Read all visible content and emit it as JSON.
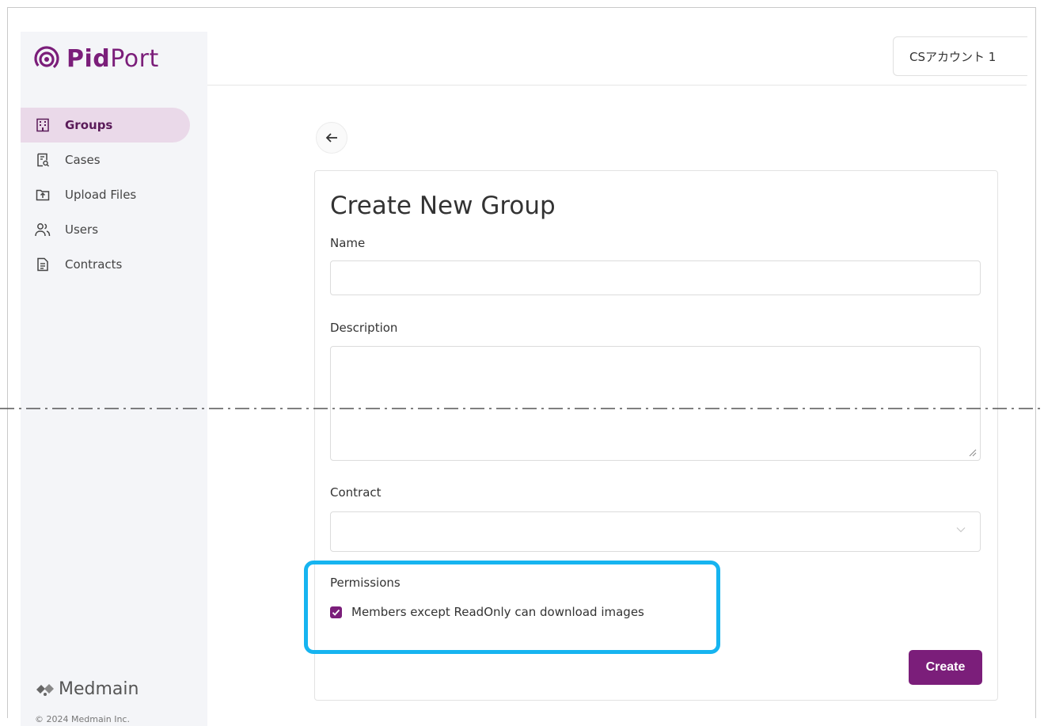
{
  "brand": {
    "name_bold": "Pid",
    "name_light": "Port",
    "footer_brand": "Medmain",
    "copyright": "© 2024 Medmain Inc."
  },
  "colors": {
    "brand": "#7b1e7a",
    "active_nav": "#ead9e9",
    "highlight": "#16b4f0"
  },
  "header": {
    "account_label": "CSアカウント 1"
  },
  "sidebar": {
    "items": [
      {
        "label": "Groups",
        "icon": "building-icon",
        "active": true
      },
      {
        "label": "Cases",
        "icon": "case-search-icon",
        "active": false
      },
      {
        "label": "Upload Files",
        "icon": "upload-icon",
        "active": false
      },
      {
        "label": "Users",
        "icon": "users-icon",
        "active": false
      },
      {
        "label": "Contracts",
        "icon": "document-icon",
        "active": false
      }
    ]
  },
  "form": {
    "title": "Create New Group",
    "name_label": "Name",
    "name_value": "",
    "description_label": "Description",
    "description_value": "",
    "contract_label": "Contract",
    "contract_value": "",
    "permissions_label": "Permissions",
    "download_permission_label": "Members except ReadOnly can download images",
    "download_permission_checked": true,
    "create_label": "Create"
  }
}
